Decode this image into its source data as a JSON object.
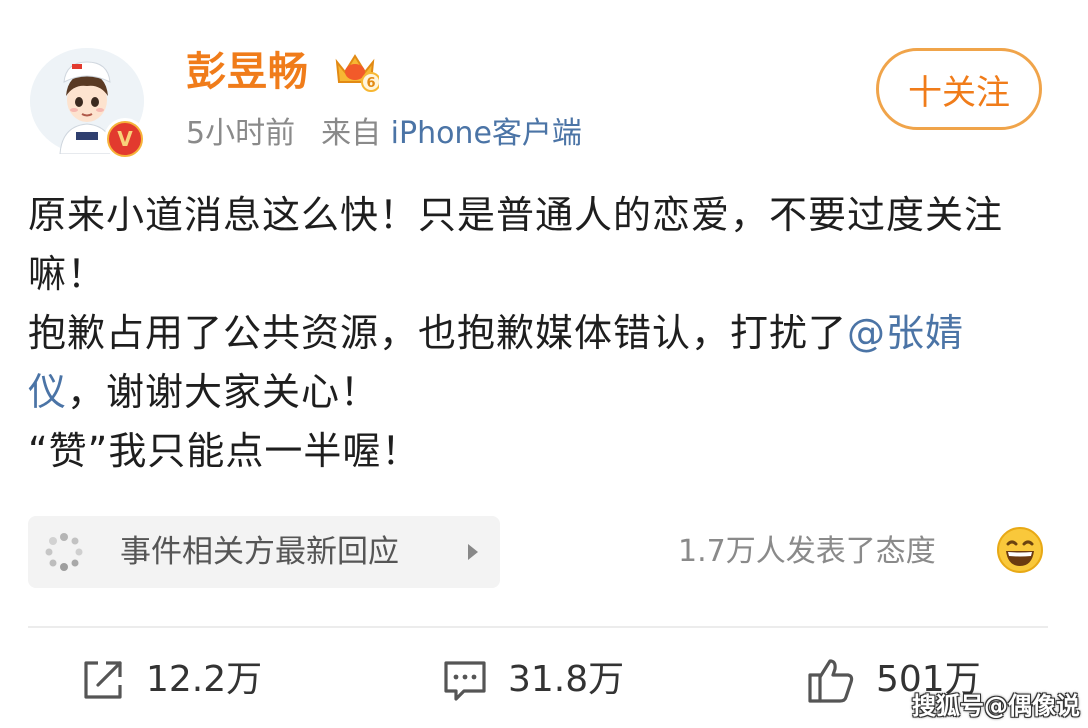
{
  "post": {
    "author": "彭昱畅",
    "time": "5小时前",
    "source_prefix": "来自",
    "source_client": "iPhone客户端",
    "follow_label": "十关注",
    "verified_badge": "V",
    "member_level": "6",
    "content": {
      "line1": "原来小道消息这么快！只是普通人的恋爱，不要过度关注嘛！",
      "line2_before": "抱歉占用了公共资源，也抱歉媒体错认，打扰了",
      "mention": "@张婧仪",
      "line2_after": "，谢谢大家关心！",
      "line3": "“赞”我只能点一半喔！"
    },
    "event": {
      "label": "事件相关方最新回应"
    },
    "attitude": "1.7万人发表了态度",
    "actions": {
      "repost": "12.2万",
      "comment": "31.8万",
      "like": "501万"
    },
    "watermark": "搜狐号@偶像说",
    "colors": {
      "name": "#f07c1a",
      "link": "#4b74a6",
      "verified": "#e23a2e"
    }
  }
}
